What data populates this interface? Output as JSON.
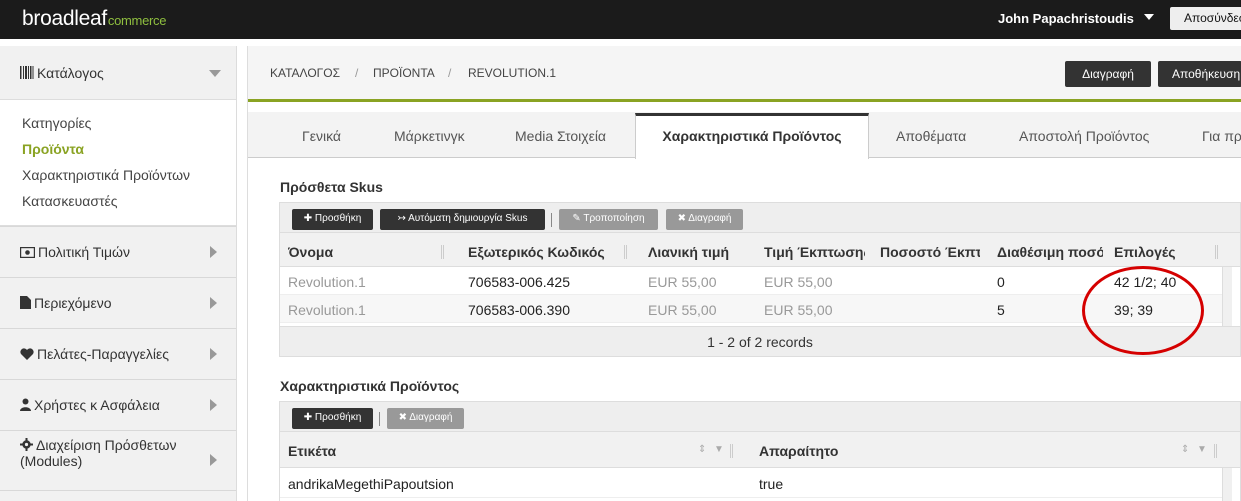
{
  "topbar": {
    "logo_main": "broadleaf",
    "logo_sub": "commerce",
    "user_name": "John Papachristoudis",
    "logout_label": "Αποσύνδεση"
  },
  "sidebar": {
    "catalog": {
      "label": "Κατάλογος",
      "items": [
        {
          "label": "Κατηγορίες",
          "active": false
        },
        {
          "label": "Προϊόντα",
          "active": true
        },
        {
          "label": "Χαρακτηριστικά Προϊόντων",
          "active": false
        },
        {
          "label": "Κατασκευαστές",
          "active": false
        }
      ]
    },
    "sections": [
      {
        "label": "Πολιτική Τιμών",
        "icon": "money-icon"
      },
      {
        "label": "Περιεχόμενο",
        "icon": "file-icon"
      },
      {
        "label": "Πελάτες-Παραγγελίες",
        "icon": "heart-icon"
      },
      {
        "label": "Χρήστες κ Ασφάλεια",
        "icon": "user-icon"
      },
      {
        "label": "Διαχείριση Πρόσθετων (Modules)",
        "icon": "gear-icon"
      }
    ]
  },
  "breadcrumb": {
    "items": [
      "ΚΑΤΑΛΟΓΟΣ",
      "ΠΡΟΪΟΝΤΑ",
      "REVOLUTION.1"
    ],
    "separator": "/"
  },
  "actions": {
    "delete_label": "Διαγραφή",
    "save_label": "Αποθήκευση"
  },
  "tabs": {
    "items": [
      "Γενικά",
      "Μάρκετινγκ",
      "Media Στοιχεία",
      "Χαρακτηριστικά Προϊόντος",
      "Αποθέματα",
      "Αποστολή Προϊόντος",
      "Για προϊόντα"
    ],
    "active": "Χαρακτηριστικά Προϊόντος"
  },
  "skus": {
    "title": "Πρόσθετα Skus",
    "toolbar": {
      "add": "Προσθήκη",
      "auto": "Αυτόματη δημιουργία Skus",
      "edit": "Τροποποίηση",
      "delete": "Διαγραφή"
    },
    "columns": [
      "Όνομα",
      "Εξωτερικός Κωδικός",
      "Λιανική τιμή",
      "Τιμή Έκπτωσης",
      "Ποσοστό Έκπτωσης",
      "Διαθέσιμη ποσότητα",
      "Επιλογές"
    ],
    "rows": [
      {
        "name": "Revolution.1",
        "code": "706583-006.425",
        "retail": "EUR 55,00",
        "sale": "EUR 55,00",
        "percent": "",
        "qty": "0",
        "options": "42 1/2; 40"
      },
      {
        "name": "Revolution.1",
        "code": "706583-006.390",
        "retail": "EUR 55,00",
        "sale": "EUR 55,00",
        "percent": "",
        "qty": "5",
        "options": "39; 39"
      }
    ],
    "footer": "1 - 2 of 2 records"
  },
  "attributes": {
    "title": "Χαρακτηριστικά Προϊόντος",
    "toolbar": {
      "add": "Προσθήκη",
      "delete": "Διαγραφή"
    },
    "columns": [
      "Ετικέτα",
      "Απαραίτητο"
    ],
    "rows": [
      {
        "label": "andrikaMegethiPapoutsion",
        "required": "true"
      }
    ]
  },
  "colors": {
    "accent": "#8aa323",
    "highlight_circle": "#d50000",
    "topbar": "#1b1b1b"
  }
}
